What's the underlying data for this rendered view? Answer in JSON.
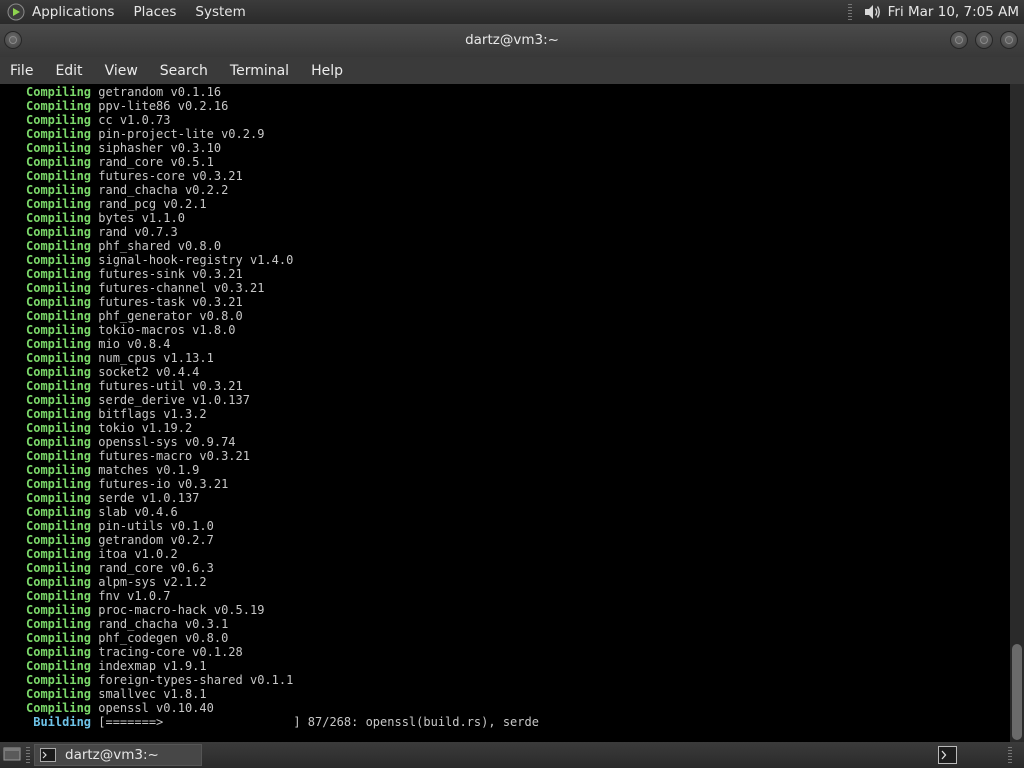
{
  "top_panel": {
    "menus": [
      "Applications",
      "Places",
      "System"
    ],
    "clock": "Fri Mar 10,  7:05 AM",
    "logo_icon": "distro-logo-icon",
    "volume_icon": "speaker-volume-icon"
  },
  "window": {
    "title": "dartz@vm3:~",
    "menu": [
      "File",
      "Edit",
      "View",
      "Search",
      "Terminal",
      "Help"
    ]
  },
  "terminal": {
    "colors": {
      "keyword": "#7bd96a",
      "building": "#6ec3e8",
      "text": "#c7c7c7",
      "background": "#000000"
    },
    "lines": [
      {
        "kw": "Compiling",
        "text": " getrandom v0.1.16"
      },
      {
        "kw": "Compiling",
        "text": " ppv-lite86 v0.2.16"
      },
      {
        "kw": "Compiling",
        "text": " cc v1.0.73"
      },
      {
        "kw": "Compiling",
        "text": " pin-project-lite v0.2.9"
      },
      {
        "kw": "Compiling",
        "text": " siphasher v0.3.10"
      },
      {
        "kw": "Compiling",
        "text": " rand_core v0.5.1"
      },
      {
        "kw": "Compiling",
        "text": " futures-core v0.3.21"
      },
      {
        "kw": "Compiling",
        "text": " rand_chacha v0.2.2"
      },
      {
        "kw": "Compiling",
        "text": " rand_pcg v0.2.1"
      },
      {
        "kw": "Compiling",
        "text": " bytes v1.1.0"
      },
      {
        "kw": "Compiling",
        "text": " rand v0.7.3"
      },
      {
        "kw": "Compiling",
        "text": " phf_shared v0.8.0"
      },
      {
        "kw": "Compiling",
        "text": " signal-hook-registry v1.4.0"
      },
      {
        "kw": "Compiling",
        "text": " futures-sink v0.3.21"
      },
      {
        "kw": "Compiling",
        "text": " futures-channel v0.3.21"
      },
      {
        "kw": "Compiling",
        "text": " futures-task v0.3.21"
      },
      {
        "kw": "Compiling",
        "text": " phf_generator v0.8.0"
      },
      {
        "kw": "Compiling",
        "text": " tokio-macros v1.8.0"
      },
      {
        "kw": "Compiling",
        "text": " mio v0.8.4"
      },
      {
        "kw": "Compiling",
        "text": " num_cpus v1.13.1"
      },
      {
        "kw": "Compiling",
        "text": " socket2 v0.4.4"
      },
      {
        "kw": "Compiling",
        "text": " futures-util v0.3.21"
      },
      {
        "kw": "Compiling",
        "text": " serde_derive v1.0.137"
      },
      {
        "kw": "Compiling",
        "text": " bitflags v1.3.2"
      },
      {
        "kw": "Compiling",
        "text": " tokio v1.19.2"
      },
      {
        "kw": "Compiling",
        "text": " openssl-sys v0.9.74"
      },
      {
        "kw": "Compiling",
        "text": " futures-macro v0.3.21"
      },
      {
        "kw": "Compiling",
        "text": " matches v0.1.9"
      },
      {
        "kw": "Compiling",
        "text": " futures-io v0.3.21"
      },
      {
        "kw": "Compiling",
        "text": " serde v1.0.137"
      },
      {
        "kw": "Compiling",
        "text": " slab v0.4.6"
      },
      {
        "kw": "Compiling",
        "text": " pin-utils v0.1.0"
      },
      {
        "kw": "Compiling",
        "text": " getrandom v0.2.7"
      },
      {
        "kw": "Compiling",
        "text": " itoa v1.0.2"
      },
      {
        "kw": "Compiling",
        "text": " rand_core v0.6.3"
      },
      {
        "kw": "Compiling",
        "text": " alpm-sys v2.1.2"
      },
      {
        "kw": "Compiling",
        "text": " fnv v1.0.7"
      },
      {
        "kw": "Compiling",
        "text": " proc-macro-hack v0.5.19"
      },
      {
        "kw": "Compiling",
        "text": " rand_chacha v0.3.1"
      },
      {
        "kw": "Compiling",
        "text": " phf_codegen v0.8.0"
      },
      {
        "kw": "Compiling",
        "text": " tracing-core v0.1.28"
      },
      {
        "kw": "Compiling",
        "text": " indexmap v1.9.1"
      },
      {
        "kw": "Compiling",
        "text": " foreign-types-shared v0.1.1"
      },
      {
        "kw": "Compiling",
        "text": " smallvec v1.8.1"
      },
      {
        "kw": "Compiling",
        "text": " openssl v0.10.40"
      }
    ],
    "status": {
      "kw": " Building",
      "text": " [=======>                  ] 87/268: openssl(build.rs), serde"
    },
    "progress_fraction": 0.325
  },
  "taskbar": {
    "task_label": "dartz@vm3:~",
    "show_desktop_icon": "show-desktop-icon",
    "terminal_tray_icon": "terminal-icon"
  }
}
